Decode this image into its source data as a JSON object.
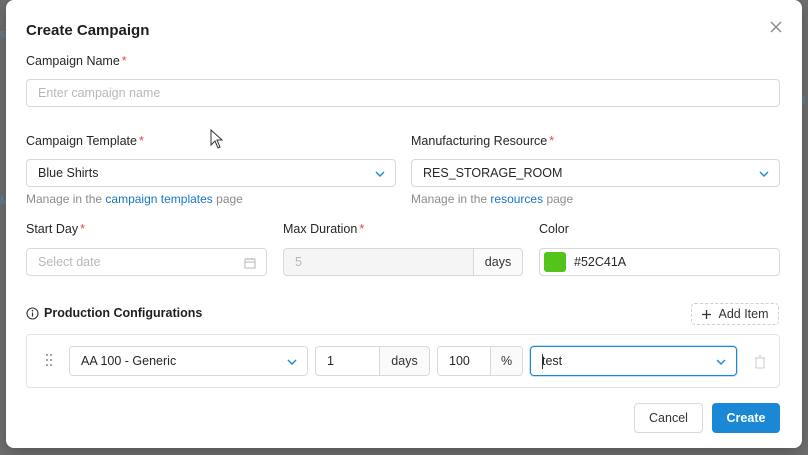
{
  "modal": {
    "title": "Create Campaign",
    "close_icon": "close-icon"
  },
  "campaign_name": {
    "label": "Campaign Name",
    "required": "*",
    "placeholder": "Enter campaign name"
  },
  "campaign_template": {
    "label": "Campaign Template",
    "required": "*",
    "value": "Blue Shirts",
    "hint_prefix": "Manage in the",
    "hint_link": "campaign templates",
    "hint_suffix": "page"
  },
  "manufacturing_resource": {
    "label": "Manufacturing Resource",
    "required": "*",
    "value": "RES_STORAGE_ROOM",
    "hint_prefix": "Manage in the",
    "hint_link": "resources",
    "hint_suffix": "page"
  },
  "start_day": {
    "label": "Start Day",
    "required": "*",
    "placeholder": "Select date",
    "icon": "calendar-icon"
  },
  "max_duration": {
    "label": "Max Duration",
    "required": "*",
    "value": "5",
    "unit": "days"
  },
  "color": {
    "label": "Color",
    "value": "#52C41A",
    "swatch": "#52C41A"
  },
  "production": {
    "title": "Production Configurations",
    "add_label": "Add Item",
    "rows": [
      {
        "item": "AA 100 - Generic",
        "qty": "1",
        "qty_unit": "days",
        "percent": "100",
        "percent_unit": "%",
        "tag": "test"
      }
    ]
  },
  "footer": {
    "cancel": "Cancel",
    "create": "Create"
  },
  "colors": {
    "primary": "#1a88d4",
    "required": "#e5484d",
    "link": "#1677c8"
  }
}
